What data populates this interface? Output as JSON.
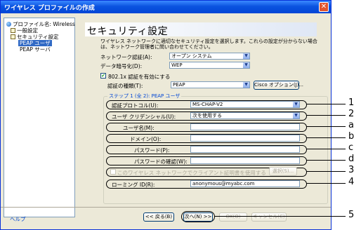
{
  "window": {
    "title": "ワイヤレス プロファイルの作成",
    "close_glyph": "✕"
  },
  "tree": {
    "items": [
      {
        "label": "プロファイル名: Wireless"
      },
      {
        "label": "一般設定"
      },
      {
        "label": "セキュリティ設定"
      },
      {
        "label": "PEAP ユーザ"
      },
      {
        "label": "PEAP サーバ"
      }
    ]
  },
  "page": {
    "title": "セキュリティ設定",
    "description": "ワイヤレス ネットワークに適切なセキュリティ設定を選択します。これらの設定が分からない場合は、ネットワーク管理者に問い合わせてください。"
  },
  "network_auth": {
    "label": "ネットワーク認証(A):",
    "value": "オープン システム"
  },
  "data_encryption": {
    "label": "データ暗号化(D):",
    "value": "WEP"
  },
  "enable_8021x": {
    "label": "802.1x 認証を有効にする",
    "checked": true
  },
  "auth_type": {
    "label": "認証の種類(T):",
    "value": "PEAP",
    "cisco_button": "Cisco オプション(J)..."
  },
  "step_title": "ステップ 1 (全 2): PEAP ユーザ",
  "auth_protocol": {
    "label": "認証プロトコル(U):",
    "value": "MS-CHAP-V2"
  },
  "user_credential": {
    "label": "ユーザ クリデンシャル(U):",
    "value": "次を使用する"
  },
  "username": {
    "label": "ユーザ名(M):",
    "value": ""
  },
  "domain": {
    "label": "ドメイン(O):",
    "value": ""
  },
  "password": {
    "label": "パスワード(P):",
    "value": ""
  },
  "password_confirm": {
    "label": "パスワードの確認(W):",
    "value": ""
  },
  "client_cert": {
    "label": "このワイヤレス ネットワークでクライアント証明書を使用する",
    "select_button": "選択(S)..."
  },
  "roaming_id": {
    "label": "ローミング ID(R):",
    "value": "anonymous@myabc.com"
  },
  "footer": {
    "help": "ヘルプ",
    "back": "<< 戻る(B)",
    "next": "次へ(N) >>",
    "ok": "OK(O)",
    "cancel": "キャンセル(C)"
  },
  "callouts": [
    "1",
    "2",
    "a",
    "b",
    "c",
    "d",
    "3",
    "4",
    "5"
  ],
  "colors": {
    "titlebar": "#0a53e0",
    "window_bg": "#ece9d8",
    "link": "#0046d5"
  }
}
